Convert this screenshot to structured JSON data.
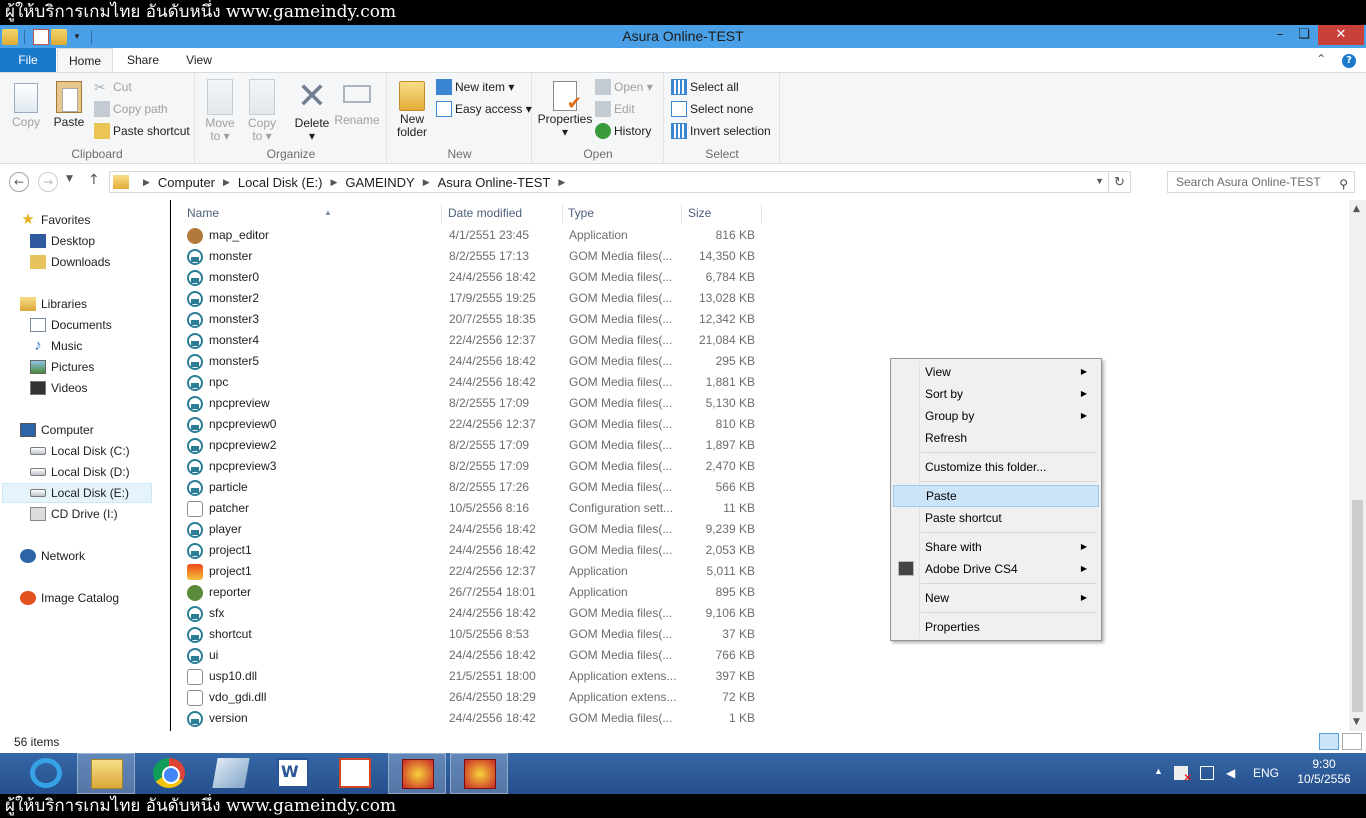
{
  "banner": {
    "top": "ผู้ให้บริการเกมไทย อันดับหนึ่ง www.gameindy.com",
    "bottom": "ผู้ให้บริการเกมไทย อันดับหนึ่ง www.gameindy.com"
  },
  "window": {
    "title": "Asura Online-TEST",
    "minimize": "–",
    "maximize": "❏",
    "close": "✕"
  },
  "tabs": {
    "file": "File",
    "home": "Home",
    "share": "Share",
    "view": "View",
    "help": "?"
  },
  "ribbon": {
    "clipboard": {
      "label": "Clipboard",
      "copy": "Copy",
      "paste": "Paste",
      "cut": "Cut",
      "copy_path": "Copy path",
      "paste_shortcut": "Paste shortcut"
    },
    "organize": {
      "label": "Organize",
      "move_to": "Move",
      "move_to_sub": "to ▾",
      "copy_to": "Copy",
      "copy_to_sub": "to ▾",
      "delete": "Delete",
      "delete_sub": "▾",
      "rename": "Rename"
    },
    "new": {
      "label": "New",
      "new_folder": "New",
      "new_folder_sub": "folder",
      "new_item": "New item ▾",
      "easy_access": "Easy access ▾"
    },
    "open": {
      "label": "Open",
      "properties": "Properties",
      "properties_sub": "▾",
      "open": "Open ▾",
      "edit": "Edit",
      "history": "History"
    },
    "select": {
      "label": "Select",
      "select_all": "Select all",
      "select_none": "Select none",
      "invert_selection": "Invert selection"
    }
  },
  "address": {
    "crumbs": [
      "Computer",
      "Local Disk (E:)",
      "GAMEINDY",
      "Asura Online-TEST"
    ],
    "search_placeholder": "Search Asura Online-TEST"
  },
  "nav": {
    "favorites": "Favorites",
    "desktop": "Desktop",
    "downloads": "Downloads",
    "libraries": "Libraries",
    "documents": "Documents",
    "music": "Music",
    "pictures": "Pictures",
    "videos": "Videos",
    "computer": "Computer",
    "disk_c": "Local Disk (C:)",
    "disk_d": "Local Disk (D:)",
    "disk_e": "Local Disk (E:)",
    "cd_drive": "CD Drive (I:)",
    "network": "Network",
    "image_catalog": "Image Catalog"
  },
  "columns": {
    "name": "Name",
    "date": "Date modified",
    "type": "Type",
    "size": "Size"
  },
  "files": [
    {
      "name": "map_editor",
      "date": "4/1/2551 23:45",
      "type": "Application",
      "size": "816 KB",
      "icon": "map"
    },
    {
      "name": "monster",
      "date": "8/2/2555 17:13",
      "type": "GOM Media files(...",
      "size": "14,350 KB",
      "icon": "gom"
    },
    {
      "name": "monster0",
      "date": "24/4/2556 18:42",
      "type": "GOM Media files(...",
      "size": "6,784 KB",
      "icon": "gom"
    },
    {
      "name": "monster2",
      "date": "17/9/2555 19:25",
      "type": "GOM Media files(...",
      "size": "13,028 KB",
      "icon": "gom"
    },
    {
      "name": "monster3",
      "date": "20/7/2555 18:35",
      "type": "GOM Media files(...",
      "size": "12,342 KB",
      "icon": "gom"
    },
    {
      "name": "monster4",
      "date": "22/4/2556 12:37",
      "type": "GOM Media files(...",
      "size": "21,084 KB",
      "icon": "gom"
    },
    {
      "name": "monster5",
      "date": "24/4/2556 18:42",
      "type": "GOM Media files(...",
      "size": "295 KB",
      "icon": "gom"
    },
    {
      "name": "npc",
      "date": "24/4/2556 18:42",
      "type": "GOM Media files(...",
      "size": "1,881 KB",
      "icon": "gom"
    },
    {
      "name": "npcpreview",
      "date": "8/2/2555 17:09",
      "type": "GOM Media files(...",
      "size": "5,130 KB",
      "icon": "gom"
    },
    {
      "name": "npcpreview0",
      "date": "22/4/2556 12:37",
      "type": "GOM Media files(...",
      "size": "810 KB",
      "icon": "gom"
    },
    {
      "name": "npcpreview2",
      "date": "8/2/2555 17:09",
      "type": "GOM Media files(...",
      "size": "1,897 KB",
      "icon": "gom"
    },
    {
      "name": "npcpreview3",
      "date": "8/2/2555 17:09",
      "type": "GOM Media files(...",
      "size": "2,470 KB",
      "icon": "gom"
    },
    {
      "name": "particle",
      "date": "8/2/2555 17:26",
      "type": "GOM Media files(...",
      "size": "566 KB",
      "icon": "gom"
    },
    {
      "name": "patcher",
      "date": "10/5/2556 8:16",
      "type": "Configuration sett...",
      "size": "11 KB",
      "icon": "cfg"
    },
    {
      "name": "player",
      "date": "24/4/2556 18:42",
      "type": "GOM Media files(...",
      "size": "9,239 KB",
      "icon": "gom"
    },
    {
      "name": "project1",
      "date": "24/4/2556 18:42",
      "type": "GOM Media files(...",
      "size": "2,053 KB",
      "icon": "gom"
    },
    {
      "name": "project1",
      "date": "22/4/2556 12:37",
      "type": "Application",
      "size": "5,011 KB",
      "icon": "app"
    },
    {
      "name": "reporter",
      "date": "26/7/2554 18:01",
      "type": "Application",
      "size": "895 KB",
      "icon": "rep"
    },
    {
      "name": "sfx",
      "date": "24/4/2556 18:42",
      "type": "GOM Media files(...",
      "size": "9,106 KB",
      "icon": "gom"
    },
    {
      "name": "shortcut",
      "date": "10/5/2556 8:53",
      "type": "GOM Media files(...",
      "size": "37 KB",
      "icon": "gom"
    },
    {
      "name": "ui",
      "date": "24/4/2556 18:42",
      "type": "GOM Media files(...",
      "size": "766 KB",
      "icon": "gom"
    },
    {
      "name": "usp10.dll",
      "date": "21/5/2551 18:00",
      "type": "Application extens...",
      "size": "397 KB",
      "icon": "dll"
    },
    {
      "name": "vdo_gdi.dll",
      "date": "26/4/2550 18:29",
      "type": "Application extens...",
      "size": "72 KB",
      "icon": "dll"
    },
    {
      "name": "version",
      "date": "24/4/2556 18:42",
      "type": "GOM Media files(...",
      "size": "1 KB",
      "icon": "gom"
    }
  ],
  "status": {
    "count": "56 items"
  },
  "context_menu": {
    "view": "View",
    "sort_by": "Sort by",
    "group_by": "Group by",
    "refresh": "Refresh",
    "customize": "Customize this folder...",
    "paste": "Paste",
    "paste_shortcut": "Paste shortcut",
    "share_with": "Share with",
    "adobe_drive": "Adobe Drive CS4",
    "new": "New",
    "properties": "Properties"
  },
  "tray": {
    "lang": "ENG",
    "time": "9:30",
    "date": "10/5/2556"
  }
}
